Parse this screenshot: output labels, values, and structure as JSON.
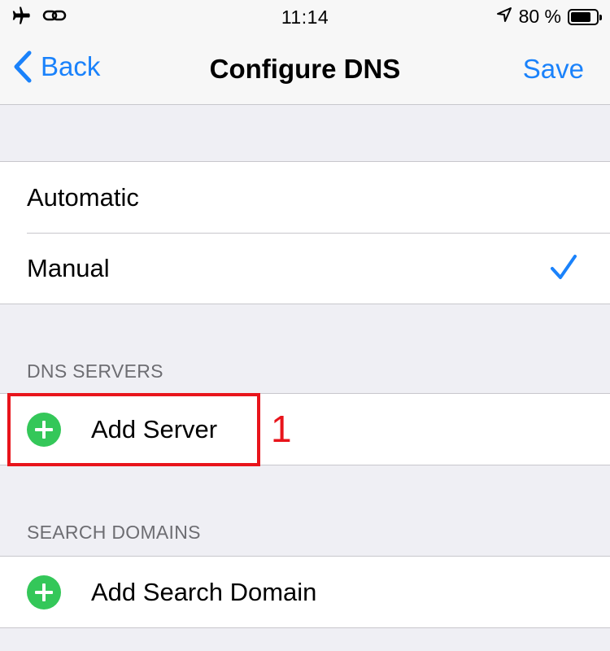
{
  "status_bar": {
    "time": "11:14",
    "battery_percent": "80 %",
    "battery_level": 0.8,
    "icons": [
      "airplane-icon",
      "link-icon",
      "location-arrow-icon",
      "battery-icon"
    ]
  },
  "nav": {
    "back_label": "Back",
    "title": "Configure DNS",
    "save_label": "Save",
    "accent_color": "#1a82fb"
  },
  "mode_options": [
    {
      "label": "Automatic",
      "selected": false
    },
    {
      "label": "Manual",
      "selected": true
    }
  ],
  "dns_servers": {
    "header": "DNS SERVERS",
    "add_label": "Add Server"
  },
  "search_domains": {
    "header": "SEARCH DOMAINS",
    "add_label": "Add Search Domain"
  },
  "annotation": {
    "number": "1",
    "color": "#e8141b"
  }
}
